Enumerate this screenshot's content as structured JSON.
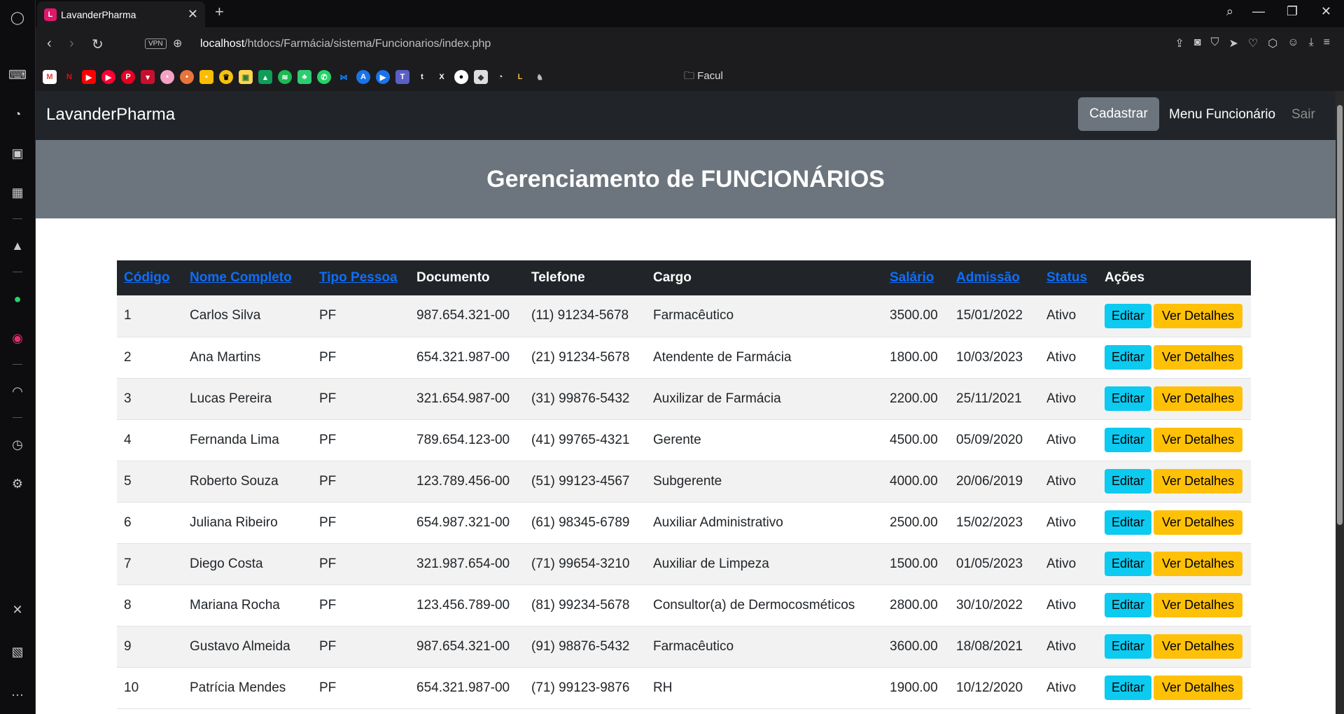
{
  "browser": {
    "tab_title": "LavanderPharma",
    "url_host": "localhost",
    "url_path": "/htdocs/Farmácia/sistema/Funcionarios/index.php",
    "vpn_label": "VPN",
    "bookmark_folder": "Facul"
  },
  "navbar": {
    "brand": "LavanderPharma",
    "cadastrar": "Cadastrar",
    "menu_funcionario": "Menu Funcionário",
    "sair": "Sair"
  },
  "hero": {
    "title": "Gerenciamento de FUNCIONÁRIOS"
  },
  "table": {
    "headers": [
      "Código",
      "Nome Completo",
      "Tipo Pessoa",
      "Documento",
      "Telefone",
      "Cargo",
      "Salário",
      "Admissão",
      "Status",
      "Ações"
    ],
    "edit_label": "Editar",
    "details_label": "Ver Detalhes",
    "rows": [
      [
        "1",
        "Carlos Silva",
        "PF",
        "987.654.321-00",
        "(11) 91234-5678",
        "Farmacêutico",
        "3500.00",
        "15/01/2022",
        "Ativo"
      ],
      [
        "2",
        "Ana Martins",
        "PF",
        "654.321.987-00",
        "(21) 91234-5678",
        "Atendente de Farmácia",
        "1800.00",
        "10/03/2023",
        "Ativo"
      ],
      [
        "3",
        "Lucas Pereira",
        "PF",
        "321.654.987-00",
        "(31) 99876-5432",
        "Auxilizar de Farmácia",
        "2200.00",
        "25/11/2021",
        "Ativo"
      ],
      [
        "4",
        "Fernanda Lima",
        "PF",
        "789.654.123-00",
        "(41) 99765-4321",
        "Gerente",
        "4500.00",
        "05/09/2020",
        "Ativo"
      ],
      [
        "5",
        "Roberto Souza",
        "PF",
        "123.789.456-00",
        "(51) 99123-4567",
        "Subgerente",
        "4000.00",
        "20/06/2019",
        "Ativo"
      ],
      [
        "6",
        "Juliana Ribeiro",
        "PF",
        "654.987.321-00",
        "(61) 98345-6789",
        "Auxiliar Administrativo",
        "2500.00",
        "15/02/2023",
        "Ativo"
      ],
      [
        "7",
        "Diego Costa",
        "PF",
        "321.987.654-00",
        "(71) 99654-3210",
        "Auxiliar de Limpeza",
        "1500.00",
        "01/05/2023",
        "Ativo"
      ],
      [
        "8",
        "Mariana Rocha",
        "PF",
        "123.456.789-00",
        "(81) 99234-5678",
        "Consultor(a) de Dermocosméticos",
        "2800.00",
        "30/10/2022",
        "Ativo"
      ],
      [
        "9",
        "Gustavo Almeida",
        "PF",
        "987.654.321-00",
        "(91) 98876-5432",
        "Farmacêutico",
        "3600.00",
        "18/08/2021",
        "Ativo"
      ],
      [
        "10",
        "Patrícia Mendes",
        "PF",
        "654.321.987-00",
        "(71) 99123-9876",
        "RH",
        "1900.00",
        "10/12/2020",
        "Ativo"
      ]
    ]
  }
}
